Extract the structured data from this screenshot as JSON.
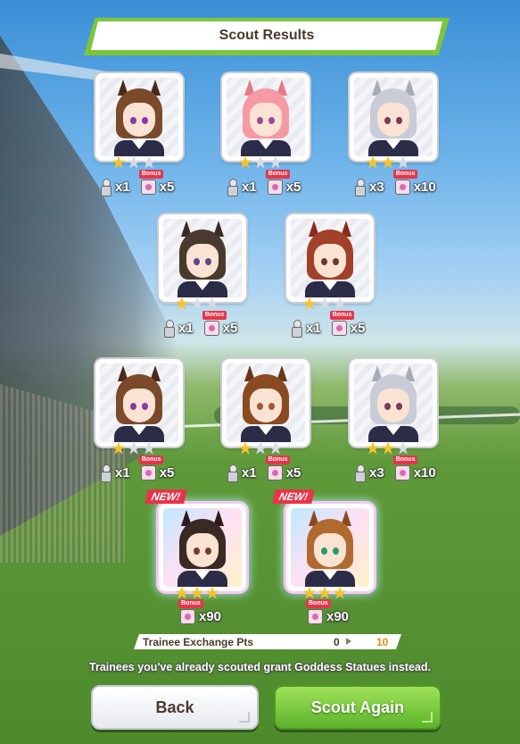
{
  "header": {
    "title": "Scout Results"
  },
  "cards": [
    {
      "id": "c1",
      "stars": 1,
      "hair": "#7a4a2a",
      "ear": "#4a2a1a",
      "eye": "#8a3aa0",
      "new": false,
      "statues": "x1",
      "pieces": "x5",
      "bonus": "Bonus"
    },
    {
      "id": "c2",
      "stars": 1,
      "hair": "#f59aa5",
      "ear": "#e57a88",
      "eye": "#9a4a9a",
      "new": false,
      "statues": "x1",
      "pieces": "x5",
      "bonus": "Bonus"
    },
    {
      "id": "c3",
      "stars": 2,
      "hair": "#c9ccd6",
      "ear": "#a8abb6",
      "eye": "#7a3a5a",
      "new": false,
      "statues": "x3",
      "pieces": "x10",
      "bonus": "Bonus"
    },
    {
      "id": "c4",
      "stars": 1,
      "hair": "#4a3a2e",
      "ear": "#3a2a20",
      "eye": "#5a4a8a",
      "new": false,
      "statues": "x1",
      "pieces": "x5",
      "bonus": "Bonus"
    },
    {
      "id": "c5",
      "stars": 1,
      "hair": "#a2402a",
      "ear": "#8a2a1a",
      "eye": "#6a3a2a",
      "new": false,
      "statues": "x1",
      "pieces": "x5",
      "bonus": "Bonus"
    },
    {
      "id": "c6",
      "stars": 1,
      "hair": "#7a4a2a",
      "ear": "#4a2a1a",
      "eye": "#8a3aa0",
      "new": false,
      "statues": "x1",
      "pieces": "x5",
      "bonus": "Bonus"
    },
    {
      "id": "c7",
      "stars": 1,
      "hair": "#8a4a22",
      "ear": "#6a3418",
      "eye": "#a55a2a",
      "new": false,
      "statues": "x1",
      "pieces": "x5",
      "bonus": "Bonus"
    },
    {
      "id": "c8",
      "stars": 2,
      "hair": "#c9ccd6",
      "ear": "#a8abb6",
      "eye": "#7a3a5a",
      "new": false,
      "statues": "x3",
      "pieces": "x10",
      "bonus": "Bonus"
    },
    {
      "id": "c9",
      "stars": 3,
      "hair": "#3a2a24",
      "ear": "#2a1a18",
      "eye": "#7a3a2a",
      "new": true,
      "new_label": "NEW!",
      "pieces": "x90",
      "bonus": "Bonus"
    },
    {
      "id": "c10",
      "stars": 3,
      "hair": "#b06a30",
      "ear": "#8a4a20",
      "eye": "#2a9a6a",
      "new": true,
      "new_label": "NEW!",
      "pieces": "x90",
      "bonus": "Bonus"
    }
  ],
  "exchange": {
    "label": "Trainee Exchange Pts",
    "from": "0",
    "to": "10"
  },
  "notice": "Trainees you've already scouted grant Goddess Statues instead.",
  "buttons": {
    "back": "Back",
    "again": "Scout Again"
  },
  "colors": {
    "accent_green": "#7cc63a",
    "star_gold": "#f5c42c",
    "new_red": "#e8344a",
    "pts_orange": "#e58b12"
  }
}
